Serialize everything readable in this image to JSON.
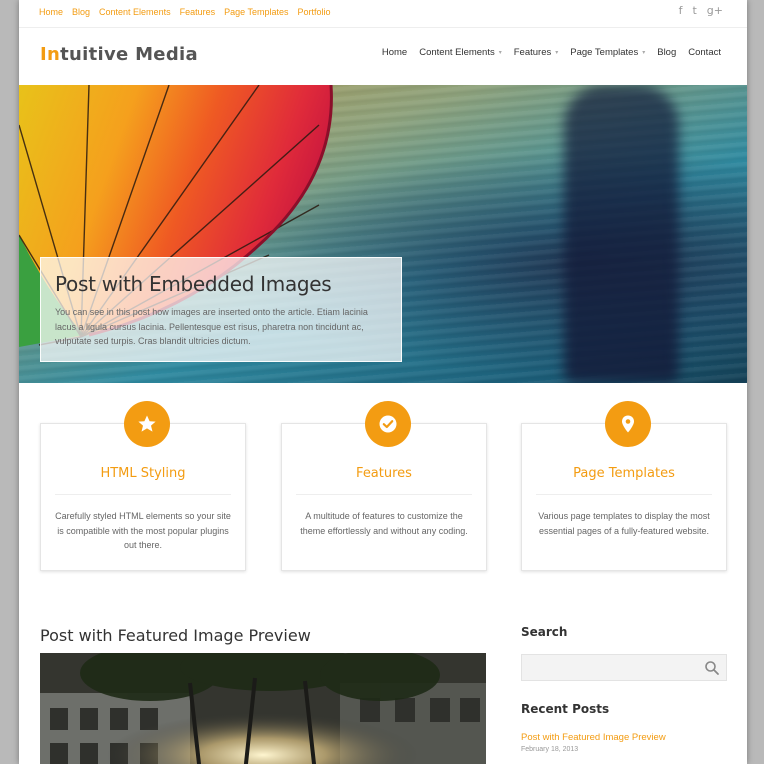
{
  "topbar": {
    "links": [
      "Home",
      "Blog",
      "Content Elements",
      "Features",
      "Page Templates",
      "Portfolio"
    ],
    "social": [
      {
        "icon": "facebook-icon",
        "glyph": "f"
      },
      {
        "icon": "twitter-icon",
        "glyph": "t"
      },
      {
        "icon": "google-plus-icon",
        "glyph": "g+"
      }
    ]
  },
  "header": {
    "logo_accent": "In",
    "logo_rest": "tuitive Media",
    "nav": [
      {
        "label": "Home",
        "dropdown": false
      },
      {
        "label": "Content Elements",
        "dropdown": true
      },
      {
        "label": "Features",
        "dropdown": true
      },
      {
        "label": "Page Templates",
        "dropdown": true
      },
      {
        "label": "Blog",
        "dropdown": false
      },
      {
        "label": "Contact",
        "dropdown": false
      }
    ],
    "caret": "▾"
  },
  "hero": {
    "title": "Post with Embedded Images",
    "text": "You can see in this post how images are inserted onto the article. Etiam lacinia lacus a ligula cursus lacinia. Pellentesque est risus, pharetra non tincidunt ac, vulputate sed turpis. Cras blandit ultricies dictum."
  },
  "features": [
    {
      "icon": "star-icon",
      "title": "HTML Styling",
      "text": "Carefully styled HTML elements so your site is compatible with the most popular plugins out there."
    },
    {
      "icon": "checkmark-icon",
      "title": "Features",
      "text": "A multitude of features to customize the theme effortlessly and without any coding."
    },
    {
      "icon": "map-pin-icon",
      "title": "Page Templates",
      "text": "Various page templates to display the most essential pages of a fully-featured website."
    }
  ],
  "post": {
    "title": "Post with Featured Image Preview"
  },
  "sidebar": {
    "search_title": "Search",
    "search_placeholder": "",
    "recent_title": "Recent Posts",
    "recent": [
      {
        "title": "Post with Featured Image Preview",
        "date": "February 18, 2013"
      }
    ]
  },
  "colors": {
    "accent": "#f39c12",
    "background": "#b9b9b9"
  }
}
